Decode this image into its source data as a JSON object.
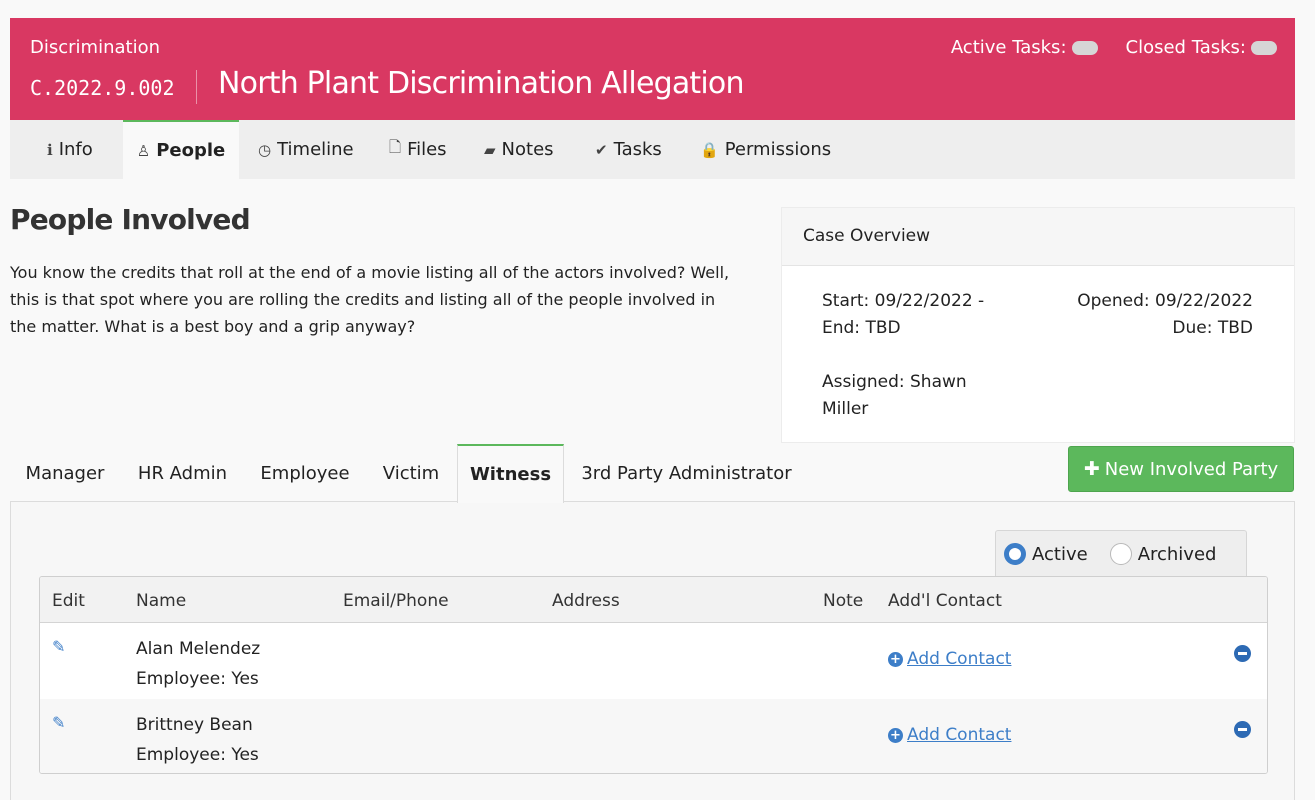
{
  "header": {
    "category": "Discrimination",
    "case_id": "C.2022.9.002",
    "title": "North Plant Discrimination Allegation",
    "active_tasks_label": "Active Tasks:",
    "closed_tasks_label": "Closed Tasks:",
    "bg_color": "#d93862"
  },
  "nav": {
    "tabs": [
      {
        "label": "Info",
        "icon": "info-circle-icon",
        "glyph": "ℹ"
      },
      {
        "label": "People",
        "icon": "user-icon",
        "glyph": "♙"
      },
      {
        "label": "Timeline",
        "icon": "clock-icon",
        "glyph": "◷"
      },
      {
        "label": "Files",
        "icon": "file-icon",
        "glyph": "🗋"
      },
      {
        "label": "Notes",
        "icon": "book-icon",
        "glyph": "▰"
      },
      {
        "label": "Tasks",
        "icon": "check-icon",
        "glyph": "✔"
      },
      {
        "label": "Permissions",
        "icon": "lock-icon",
        "glyph": "🔒"
      }
    ],
    "active": "People",
    "active_color": "#5cb85c"
  },
  "main": {
    "heading": "People Involved",
    "description": "You know the credits that roll at the end of a movie listing all of the actors involved? Well, this is that spot where you are rolling the credits and listing all of the people involved in the matter. What is a best boy and a grip anyway?"
  },
  "overview": {
    "title": "Case Overview",
    "start": "Start: 09/22/2022 -",
    "end": "End: TBD",
    "opened": "Opened: 09/22/2022",
    "due": "Due: TBD",
    "assigned": "Assigned: Shawn Miller"
  },
  "role_tabs": {
    "tabs": [
      "Manager",
      "HR Admin",
      "Employee",
      "Victim",
      "Witness",
      "3rd Party Administrator"
    ],
    "active": "Witness"
  },
  "actions": {
    "new_party_label": "New Involved Party",
    "button_color": "#5cb85c"
  },
  "filter": {
    "options": [
      "Active",
      "Archived"
    ],
    "selected": "Active"
  },
  "table": {
    "columns": [
      "Edit",
      "Name",
      "Email/Phone",
      "Address",
      "Note",
      "Add'l Contact"
    ],
    "add_contact_label": " Add Contact",
    "rows": [
      {
        "name": "Alan Melendez",
        "employee": "Employee: Yes"
      },
      {
        "name": "Brittney Bean",
        "employee": "Employee: Yes"
      }
    ],
    "link_color": "#3d7ec8"
  }
}
